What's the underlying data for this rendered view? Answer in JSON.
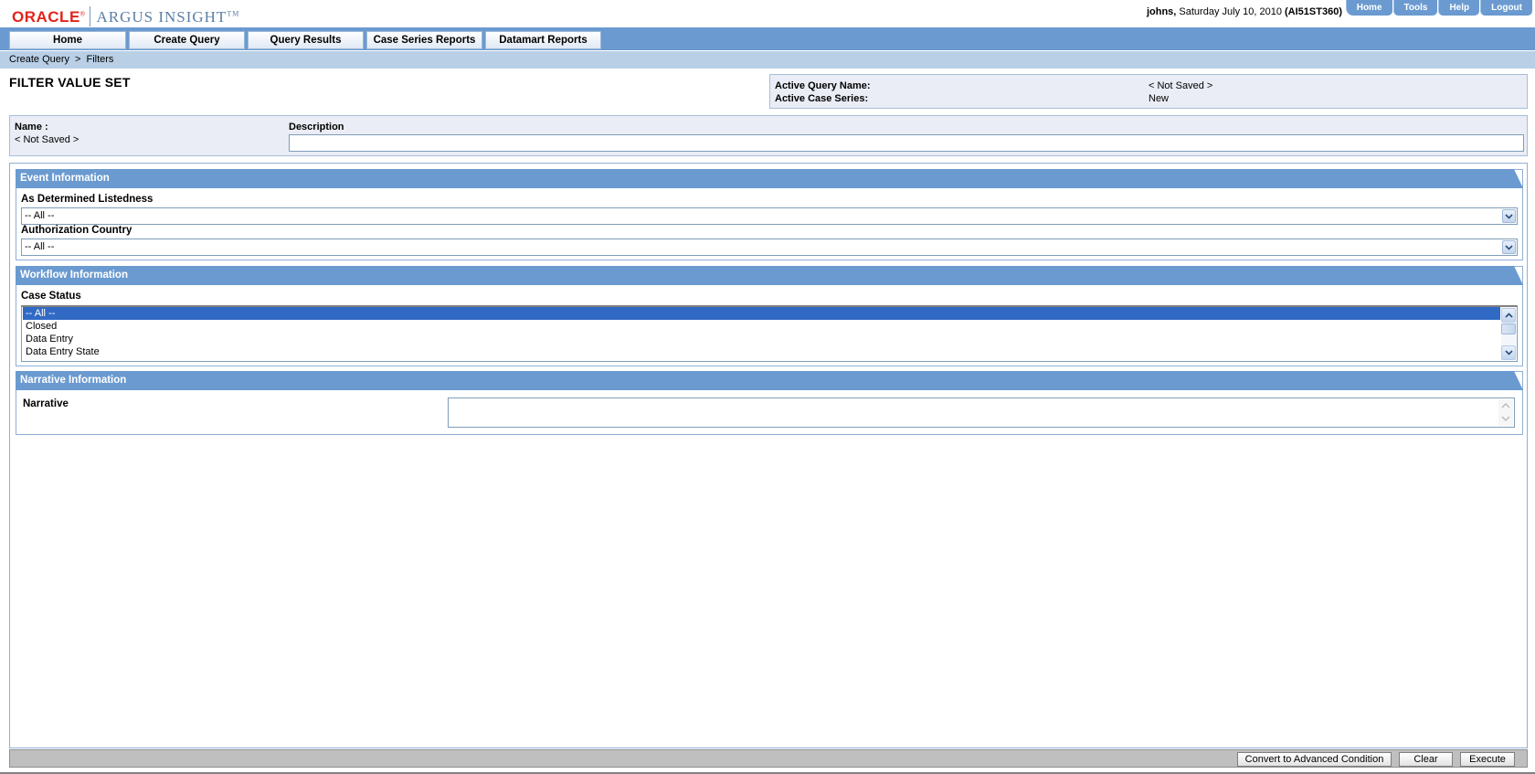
{
  "branding": {
    "oracle": "ORACLE",
    "registered": "®",
    "product": "ARGUS INSIGHT",
    "trademark": "TM"
  },
  "user": {
    "name": "johns,",
    "date": "Saturday July 10, 2010",
    "server": "(AI51ST360)"
  },
  "top_links": [
    "Home",
    "Tools",
    "Help",
    "Logout"
  ],
  "nav": [
    "Home",
    "Create Query",
    "Query Results",
    "Case Series Reports",
    "Datamart Reports"
  ],
  "breadcrumb": {
    "items": [
      "Create Query",
      "Filters"
    ],
    "separator": ">"
  },
  "page": {
    "title": "FILTER VALUE SET"
  },
  "active_query": {
    "name_label": "Active Query Name:",
    "name_value": "< Not Saved >",
    "series_label": "Active Case Series:",
    "series_value": "New"
  },
  "form": {
    "name_label": "Name :",
    "name_value": "< Not Saved >",
    "description_label": "Description",
    "description_value": ""
  },
  "sections": {
    "event": {
      "title": "Event Information",
      "listedness_label": "As Determined Listedness",
      "listedness_value": "-- All --",
      "country_label": "Authorization Country",
      "country_value": "-- All --"
    },
    "workflow": {
      "title": "Workflow Information",
      "case_status_label": "Case Status",
      "case_status_options": [
        "-- All --",
        "Closed",
        "Data Entry",
        "Data Entry State"
      ],
      "selected_index": 0
    },
    "narrative": {
      "title": "Narrative Information",
      "narrative_label": "Narrative",
      "narrative_value": ""
    }
  },
  "footer_buttons": [
    "Convert to Advanced Condition",
    "Clear",
    "Execute"
  ],
  "colors": {
    "accent": "#6a9ad0",
    "oracle_red": "#e2231a",
    "panel_bg": "#eaedf5",
    "selection": "#316ac5"
  }
}
